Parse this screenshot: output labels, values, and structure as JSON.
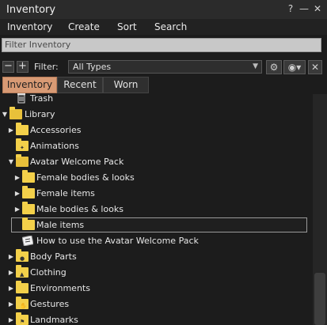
{
  "window": {
    "title": "Inventory"
  },
  "titlebar_icons": [
    "help-icon",
    "minimize-icon",
    "close-icon"
  ],
  "menu": [
    "Inventory",
    "Create",
    "Sort",
    "Search"
  ],
  "filter_input": {
    "placeholder": "Filter Inventory",
    "value": ""
  },
  "toolbar": {
    "filter_label": "Filter:",
    "filter_value": "All Types"
  },
  "tabs": [
    "Inventory",
    "Recent",
    "Worn"
  ],
  "tabs_active": "Inventory",
  "tree": [
    {
      "label": "Trash",
      "icon": "trash-icon",
      "arrow": "none"
    },
    {
      "label": "Library",
      "icon": "folder-open-icon",
      "arrow": "expanded"
    },
    {
      "label": "Accessories",
      "icon": "folder-icon",
      "arrow": "collapsed"
    },
    {
      "label": "Animations",
      "icon": "animation-folder-icon",
      "arrow": "none"
    },
    {
      "label": "Avatar Welcome Pack",
      "icon": "folder-open-icon",
      "arrow": "expanded"
    },
    {
      "label": "Female bodies & looks",
      "icon": "folder-icon",
      "arrow": "collapsed"
    },
    {
      "label": "Female items",
      "icon": "folder-icon",
      "arrow": "collapsed"
    },
    {
      "label": "Male bodies & looks",
      "icon": "folder-icon",
      "arrow": "collapsed"
    },
    {
      "label": "Male items",
      "icon": "folder-icon",
      "arrow": "none",
      "selected": true
    },
    {
      "label": "How to use the Avatar Welcome Pack",
      "icon": "notecard-icon",
      "arrow": "none"
    },
    {
      "label": "Body Parts",
      "icon": "bodyparts-folder-icon",
      "arrow": "collapsed"
    },
    {
      "label": "Clothing",
      "icon": "clothing-folder-icon",
      "arrow": "collapsed"
    },
    {
      "label": "Environments",
      "icon": "folder-icon",
      "arrow": "collapsed"
    },
    {
      "label": "Gestures",
      "icon": "gestures-folder-icon",
      "arrow": "collapsed"
    },
    {
      "label": "Landmarks",
      "icon": "landmarks-folder-icon",
      "arrow": "collapsed"
    }
  ],
  "colors": {
    "accent_tab": "#d89a74",
    "folder": "#f3d04a",
    "background": "#1c1c1c"
  }
}
